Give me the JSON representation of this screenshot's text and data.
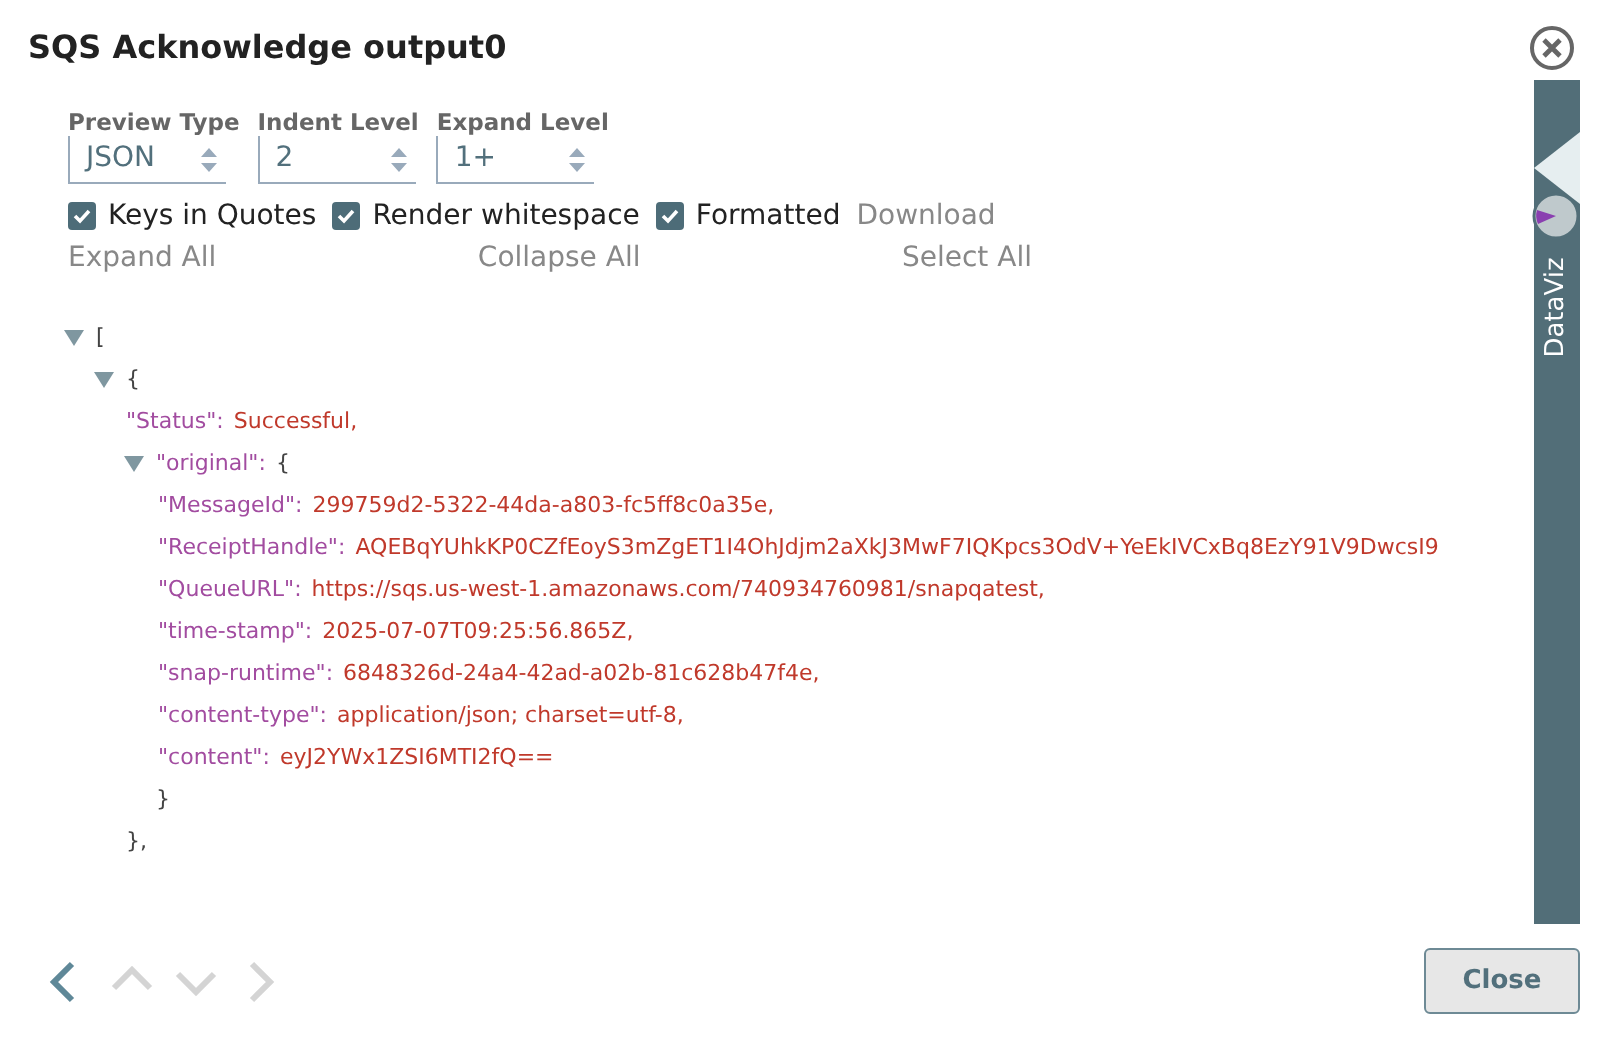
{
  "window": {
    "title": "SQS Acknowledge output0"
  },
  "selects": [
    {
      "label": "Preview Type",
      "value": "JSON"
    },
    {
      "label": "Indent Level",
      "value": "2"
    },
    {
      "label": "Expand Level",
      "value": "1+"
    }
  ],
  "checkboxes": [
    {
      "label": "Keys in Quotes",
      "checked": true
    },
    {
      "label": "Render whitespace",
      "checked": true
    },
    {
      "label": "Formatted",
      "checked": true
    }
  ],
  "links": [
    {
      "label": "Download"
    },
    {
      "label": "Expand All"
    },
    {
      "label": "Collapse All"
    },
    {
      "label": "Select All"
    }
  ],
  "tree": [
    {
      "open": "[",
      "expanded": true,
      "children": [
        {
          "open": "{",
          "expanded": true,
          "close": "},",
          "children": [
            {
              "key": "\"Status\":",
              "value": "Successful,"
            },
            {
              "key": "\"original\":",
              "open": "{",
              "expanded": true,
              "close": "}",
              "children": [
                {
                  "key": "\"MessageId\":",
                  "value": "299759d2-5322-44da-a803-fc5ff8c0a35e,"
                },
                {
                  "key": "\"ReceiptHandle\":",
                  "value": "AQEBqYUhkKP0CZfEoyS3mZgET1I4OhJdjm2aXkJ3MwF7IQKpcs3OdV+YeEkIVCxBq8EzY91V9DwcsI9"
                },
                {
                  "key": "\"QueueURL\":",
                  "value": "https://sqs.us-west-1.amazonaws.com/740934760981/snapqatest,"
                },
                {
                  "key": "\"time-stamp\":",
                  "value": "2025-07-07T09:25:56.865Z,"
                },
                {
                  "key": "\"snap-runtime\":",
                  "value": "6848326d-24a4-42ad-a02b-81c628b47f4e,"
                },
                {
                  "key": "\"content-type\":",
                  "value": "application/json; charset=utf-8,"
                },
                {
                  "key": "\"content\":",
                  "value": "eyJ2YWx1ZSI6MTI2fQ=="
                }
              ]
            }
          ]
        }
      ]
    }
  ],
  "side_tab": {
    "label": "DataViz"
  },
  "nav": [
    {
      "kind": "left",
      "disabled": false
    },
    {
      "kind": "up",
      "disabled": true
    },
    {
      "kind": "down",
      "disabled": true
    },
    {
      "kind": "right",
      "disabled": true
    }
  ],
  "buttons": [
    {
      "label": "Close"
    }
  ]
}
